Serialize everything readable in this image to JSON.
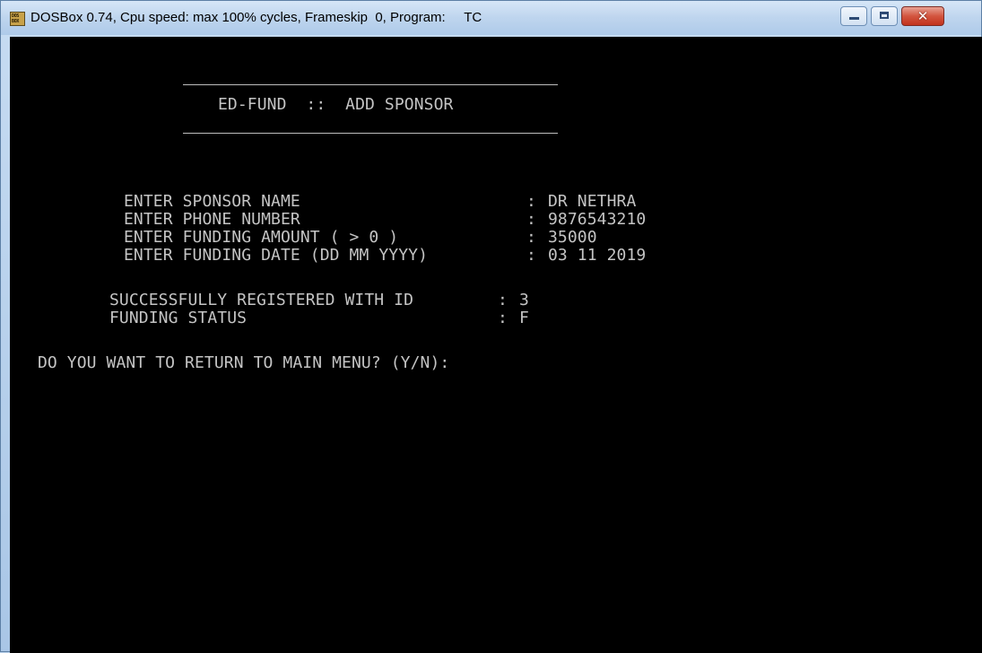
{
  "window": {
    "title": "DOSBox 0.74, Cpu speed: max 100% cycles, Frameskip  0, Program:     TC",
    "icon_text_line1": "DOS",
    "icon_text_line2": "BOX",
    "close_glyph": "✕"
  },
  "console": {
    "header_title": "ED-FUND  ::  ADD SPONSOR",
    "fields": [
      {
        "label": "ENTER SPONSOR NAME",
        "separator": ":",
        "value": "DR NETHRA"
      },
      {
        "label": "ENTER PHONE NUMBER",
        "separator": ":",
        "value": "9876543210"
      },
      {
        "label": "ENTER FUNDING AMOUNT ( > 0 )",
        "separator": ":",
        "value": "35000"
      },
      {
        "label": "ENTER FUNDING DATE (DD MM YYYY)",
        "separator": ":",
        "value": "03 11 2019"
      }
    ],
    "result": [
      {
        "label": "SUCCESSFULLY REGISTERED WITH ID",
        "separator": ":",
        "value": "3"
      },
      {
        "label": "FUNDING STATUS",
        "separator": ":",
        "value": "F"
      }
    ],
    "prompt": "DO YOU WANT TO RETURN TO MAIN MENU? (Y/N):"
  },
  "colors": {
    "console_bg": "#000000",
    "console_text": "#c4c4c4",
    "close_button": "#c2331d"
  },
  "icons": [
    "dosbox-app-icon",
    "minimize-icon",
    "maximize-icon",
    "close-icon"
  ]
}
